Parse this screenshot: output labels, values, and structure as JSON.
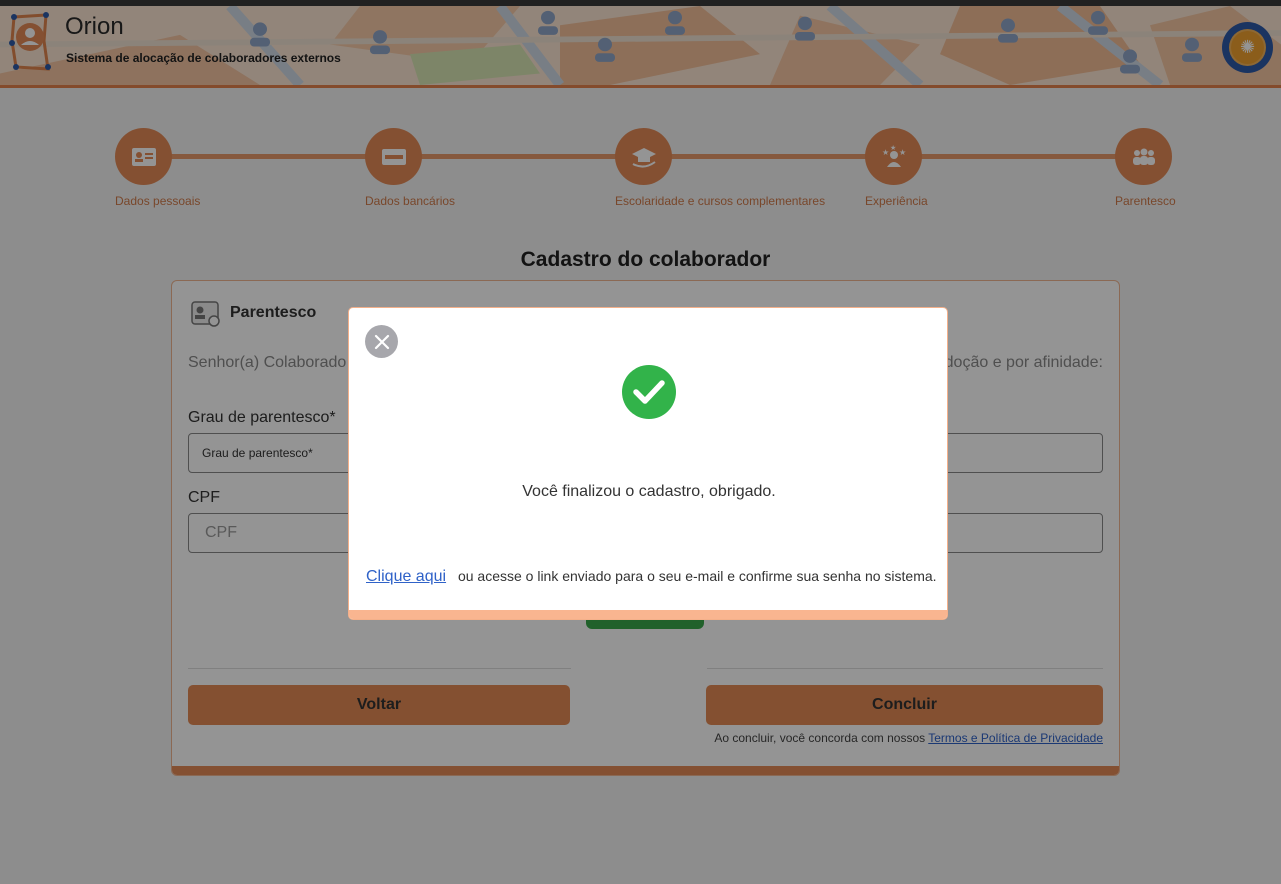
{
  "header": {
    "title": "Orion",
    "subtitle": "Sistema de alocação de colaboradores externos"
  },
  "steps": [
    {
      "label": "Dados pessoais",
      "icon": "id-card-icon"
    },
    {
      "label": "Dados bancários",
      "icon": "credit-card-icon"
    },
    {
      "label": "Escolaridade e cursos complementares",
      "icon": "graduation-cap-icon"
    },
    {
      "label": "Experiência",
      "icon": "star-person-icon"
    },
    {
      "label": "Parentesco",
      "icon": "people-group-icon"
    }
  ],
  "page": {
    "title": "Cadastro do colaborador"
  },
  "section": {
    "title": "Parentesco",
    "intro_left": "Senhor(a) Colaborado",
    "intro_right": "doção e por afinidade:"
  },
  "form": {
    "grau_label": "Grau de parentesco*",
    "grau_value": "Grau de parentesco*",
    "cpf_label": "CPF",
    "cpf_placeholder": "CPF"
  },
  "buttons": {
    "back": "Voltar",
    "finish": "Concluir"
  },
  "terms": {
    "text": "Ao concluir, você concorda com nossos",
    "link": "Termos e Política de Privacidade"
  },
  "modal": {
    "message": "Você finalizou o cadastro, obrigado.",
    "link": "Clique aqui",
    "footer_text": "ou acesse o link enviado para o seu e-mail e confirme sua senha no sistema."
  },
  "colors": {
    "accent": "#e48a57",
    "success": "#32b34a",
    "link": "#2f62c8"
  }
}
